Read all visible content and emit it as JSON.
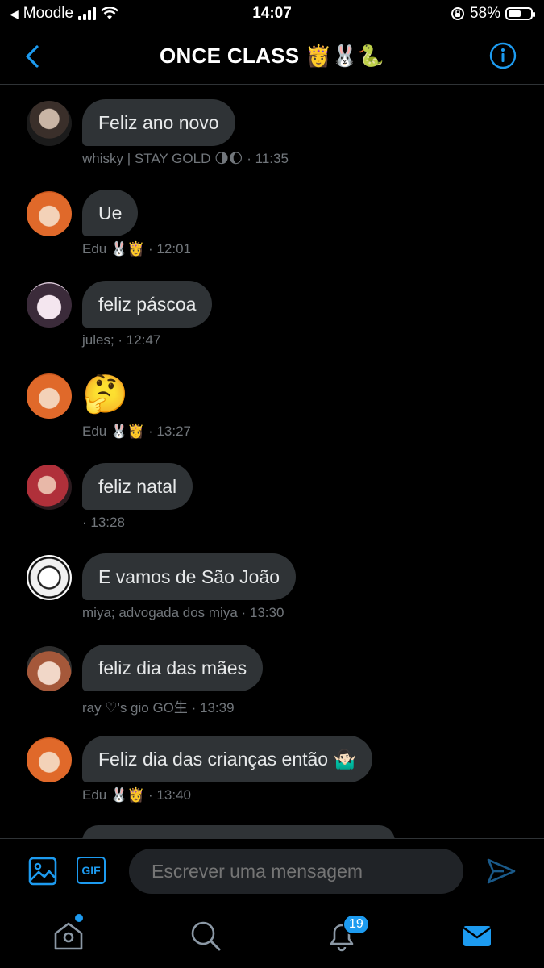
{
  "status_bar": {
    "carrier": "Moodle",
    "time": "14:07",
    "battery": "58%",
    "battery_level": 0.58
  },
  "header": {
    "title": "ONCE CLASS 👸🐰🐍"
  },
  "messages": [
    {
      "text": "Feliz ano novo",
      "sender": "whisky | STAY GOLD 🌗🌔",
      "time": "· 11:35"
    },
    {
      "text": "Ue",
      "sender": "Edu 🐰👸",
      "time": "· 12:01"
    },
    {
      "text": "feliz páscoa",
      "sender": "jules;",
      "time": "· 12:47"
    },
    {
      "text": "🤔",
      "sender": "Edu 🐰👸",
      "time": "· 13:27"
    },
    {
      "text": "feliz natal",
      "sender": "",
      "time": "· 13:28"
    },
    {
      "text": "E vamos de São João",
      "sender": "miya; advogada dos miya",
      "time": "· 13:30"
    },
    {
      "text": "feliz dia das mães",
      "sender": "ray ♡'s gio GO生",
      "time": "· 13:39"
    },
    {
      "text": "Feliz dia das crianças então 🤷🏻‍♂️",
      "sender": "Edu 🐰👸",
      "time": "· 13:40"
    }
  ],
  "composer": {
    "placeholder": "Escrever uma mensagem",
    "gif_label": "GIF"
  },
  "tabbar": {
    "notifications_count": "19"
  },
  "colors": {
    "accent": "#1d9bf0",
    "bubble": "#2f3336",
    "muted_text": "#71767b"
  },
  "icons": [
    "back-arrow-icon",
    "info-icon",
    "image-icon",
    "gif-icon",
    "send-icon",
    "home-icon",
    "search-icon",
    "bell-icon",
    "mail-icon"
  ]
}
